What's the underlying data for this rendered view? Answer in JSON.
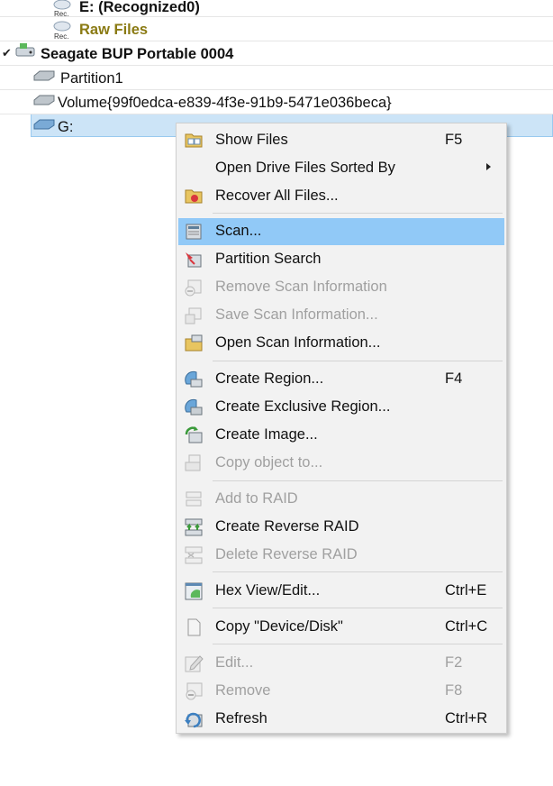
{
  "tree": {
    "rows": [
      {
        "label": "E: (Recognized0)",
        "icon": "rec-disk-icon",
        "icon_text": "Rec."
      },
      {
        "label": "Raw Files",
        "icon": "rec-disk-icon",
        "icon_text": "Rec."
      },
      {
        "label": "Seagate BUP Portable 0004",
        "icon": "hard-drive-icon"
      },
      {
        "label": "Partition1",
        "icon": "partition-icon"
      },
      {
        "label": "Volume{99f0edca-e839-4f3e-91b9-5471e036beca}",
        "icon": "partition-icon"
      },
      {
        "label": "G:",
        "icon": "partition-icon"
      }
    ]
  },
  "menu": {
    "items": [
      {
        "label": "Show Files",
        "shortcut": "F5",
        "icon": "show-files-icon",
        "disabled": false
      },
      {
        "label": "Open Drive Files Sorted By",
        "shortcut": "",
        "icon": "",
        "disabled": false,
        "submenu": true
      },
      {
        "label": "Recover All Files...",
        "shortcut": "",
        "icon": "recover-files-icon",
        "disabled": false
      },
      {
        "label": "Scan...",
        "shortcut": "",
        "icon": "scan-icon",
        "disabled": false,
        "highlighted": true
      },
      {
        "label": "Partition Search",
        "shortcut": "",
        "icon": "partition-search-icon",
        "disabled": false
      },
      {
        "label": "Remove Scan Information",
        "shortcut": "",
        "icon": "remove-scan-icon",
        "disabled": true
      },
      {
        "label": "Save Scan Information...",
        "shortcut": "",
        "icon": "save-scan-icon",
        "disabled": true
      },
      {
        "label": "Open Scan Information...",
        "shortcut": "",
        "icon": "open-scan-icon",
        "disabled": false
      },
      {
        "label": "Create Region...",
        "shortcut": "F4",
        "icon": "create-region-icon",
        "disabled": false
      },
      {
        "label": "Create Exclusive Region...",
        "shortcut": "",
        "icon": "exclusive-region-icon",
        "disabled": false
      },
      {
        "label": "Create Image...",
        "shortcut": "",
        "icon": "create-image-icon",
        "disabled": false
      },
      {
        "label": "Copy object to...",
        "shortcut": "",
        "icon": "copy-object-icon",
        "disabled": true
      },
      {
        "label": "Add to RAID",
        "shortcut": "",
        "icon": "add-raid-icon",
        "disabled": true
      },
      {
        "label": "Create Reverse RAID",
        "shortcut": "",
        "icon": "reverse-raid-icon",
        "disabled": false
      },
      {
        "label": "Delete Reverse RAID",
        "shortcut": "",
        "icon": "delete-raid-icon",
        "disabled": true
      },
      {
        "label": "Hex View/Edit...",
        "shortcut": "Ctrl+E",
        "icon": "hex-view-icon",
        "disabled": false
      },
      {
        "label": "Copy \"Device/Disk\"",
        "shortcut": "Ctrl+C",
        "icon": "copy-icon",
        "disabled": false
      },
      {
        "label": "Edit...",
        "shortcut": "F2",
        "icon": "edit-icon",
        "disabled": true
      },
      {
        "label": "Remove",
        "shortcut": "F8",
        "icon": "remove-icon",
        "disabled": true
      },
      {
        "label": "Refresh",
        "shortcut": "Ctrl+R",
        "icon": "refresh-icon",
        "disabled": false
      }
    ]
  },
  "colors": {
    "selection": "#cce4f7",
    "highlight": "#91c9f7",
    "disabled_text": "#a0a0a0",
    "raw_files_text": "#8a7a13"
  }
}
